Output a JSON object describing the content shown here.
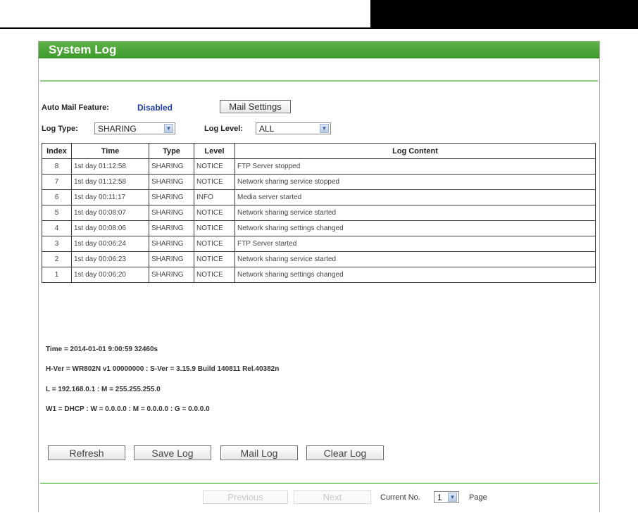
{
  "page": {
    "title": "System Log",
    "auto_mail_label": "Auto Mail Feature:",
    "auto_mail_status": "Disabled",
    "mail_settings_button": "Mail Settings",
    "log_type_label": "Log Type:",
    "log_type_value": "SHARING",
    "log_level_label": "Log Level:",
    "log_level_value": "ALL"
  },
  "table": {
    "headers": [
      "Index",
      "Time",
      "Type",
      "Level",
      "Log Content"
    ],
    "rows": [
      {
        "index": "8",
        "time": "1st day 01:12:58",
        "type": "SHARING",
        "level": "NOTICE",
        "content": "FTP Server stopped"
      },
      {
        "index": "7",
        "time": "1st day 01:12:58",
        "type": "SHARING",
        "level": "NOTICE",
        "content": "Network sharing service stopped"
      },
      {
        "index": "6",
        "time": "1st day 00:11:17",
        "type": "SHARING",
        "level": "INFO",
        "content": "Media server started"
      },
      {
        "index": "5",
        "time": "1st day 00:08:07",
        "type": "SHARING",
        "level": "NOTICE",
        "content": "Network sharing service started"
      },
      {
        "index": "4",
        "time": "1st day 00:08:06",
        "type": "SHARING",
        "level": "NOTICE",
        "content": "Network sharing settings changed"
      },
      {
        "index": "3",
        "time": "1st day 00:06:24",
        "type": "SHARING",
        "level": "NOTICE",
        "content": "FTP Server started"
      },
      {
        "index": "2",
        "time": "1st day 00:06:23",
        "type": "SHARING",
        "level": "NOTICE",
        "content": "Network sharing service started"
      },
      {
        "index": "1",
        "time": "1st day 00:06:20",
        "type": "SHARING",
        "level": "NOTICE",
        "content": "Network sharing settings changed"
      }
    ]
  },
  "info": {
    "time_line": "Time = 2014-01-01 9:00:59 32460s",
    "version_line": "H-Ver = WR802N v1 00000000 : S-Ver = 3.15.9 Build 140811 Rel.40382n",
    "lan_line": "L = 192.168.0.1    : M = 255.255.255.0",
    "wan_line": "W1 = DHCP : W = 0.0.0.0 : M = 0.0.0.0 : G = 0.0.0.0"
  },
  "actions": {
    "refresh": "Refresh",
    "save_log": "Save Log",
    "mail_log": "Mail Log",
    "clear_log": "Clear Log"
  },
  "pager": {
    "previous": "Previous",
    "next": "Next",
    "current_no_label": "Current No.",
    "current_no_value": "1",
    "page_label": "Page"
  }
}
